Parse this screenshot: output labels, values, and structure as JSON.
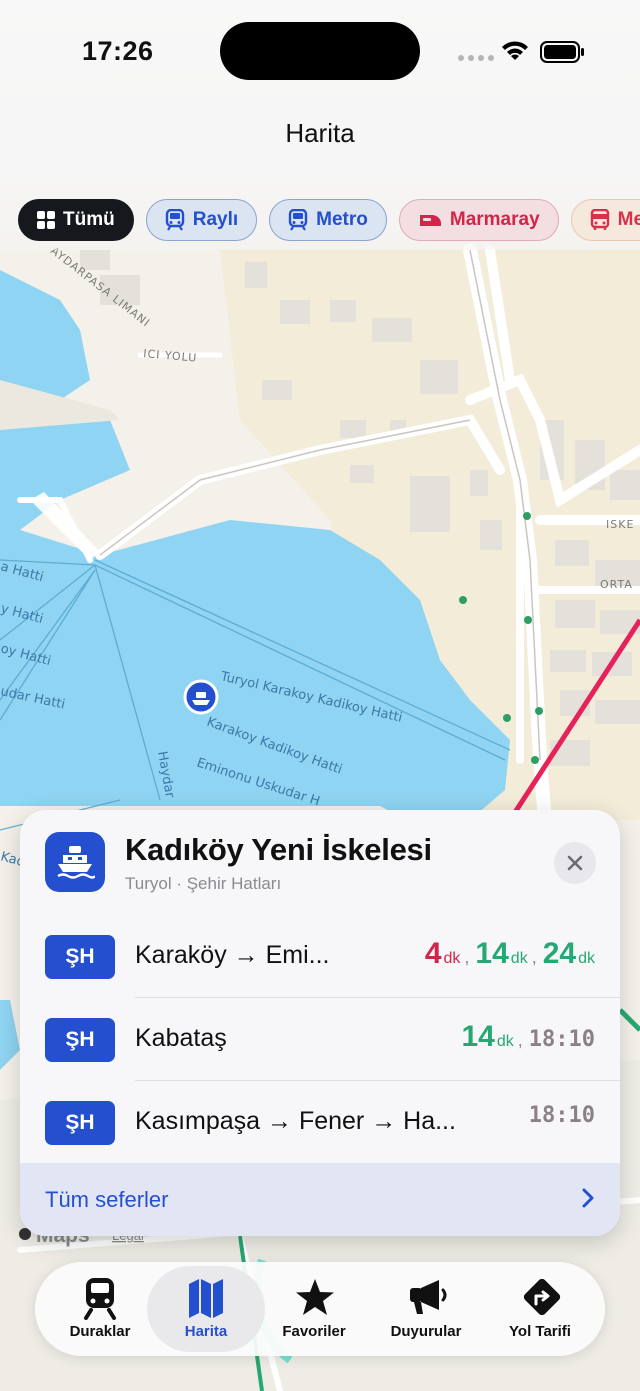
{
  "status_bar": {
    "time": "17:26"
  },
  "header": {
    "title": "Harita"
  },
  "filters": [
    {
      "label": "Tümü",
      "icon": "grid-icon",
      "selected": true
    },
    {
      "label": "Raylı",
      "icon": "tram-icon",
      "selected": false
    },
    {
      "label": "Metro",
      "icon": "metro-icon",
      "selected": false
    },
    {
      "label": "Marmaray",
      "icon": "train-icon",
      "selected": false
    },
    {
      "label": "Me",
      "icon": "bus-icon",
      "selected": false
    }
  ],
  "map": {
    "labels": {
      "port_road_1": "AYDARPASA LIMANI",
      "port_road_2": "ICI YOLU",
      "ferry_1": "Turyol Karakoy Kadikoy Hatti",
      "ferry_2": "Karakoy Kadikoy Hatti",
      "ferry_3": "Eminonu Uskudar H",
      "line_left_1": "a Hatti",
      "line_left_2": "y Hatti",
      "line_left_3": "oy Hatti",
      "line_left_4": "udar Hatti",
      "line_left_5": "Kad",
      "line_vertical": "Haydar",
      "street_1": "ISKE",
      "street_2": "ORTA",
      "maps_brand": "Maps",
      "legal": "Legal"
    }
  },
  "stop_card": {
    "name": "Kadıköy Yeni İskelesi",
    "subtitle": "Turyol · Şehir Hatları",
    "routes": [
      {
        "badge": "ŞH",
        "name": "Karaköy → Emi...",
        "times": [
          {
            "value": "4",
            "unit": "dk",
            "color": "#d32549"
          },
          {
            "value": "14",
            "unit": "dk",
            "color": "#27a872"
          },
          {
            "value": "24",
            "unit": "dk",
            "color": "#27a872"
          }
        ]
      },
      {
        "badge": "ŞH",
        "name": "Kabataş",
        "times": [
          {
            "value": "14",
            "unit": "dk",
            "color": "#27a872"
          }
        ],
        "scheduled": "18:10"
      },
      {
        "badge": "ŞH",
        "name": "Kasımpaşa → Fener → Ha...",
        "scheduled": "18:10"
      }
    ],
    "footer_label": "Tüm seferler"
  },
  "tab_bar": {
    "tabs": [
      {
        "label": "Duraklar",
        "icon": "tram-icon",
        "active": false
      },
      {
        "label": "Harita",
        "icon": "map-icon",
        "active": true
      },
      {
        "label": "Favoriler",
        "icon": "star-icon",
        "active": false
      },
      {
        "label": "Duyurular",
        "icon": "megaphone-icon",
        "active": false
      },
      {
        "label": "Yol Tarifi",
        "icon": "directions-icon",
        "active": false
      }
    ]
  },
  "colors": {
    "accent": "#2450d0",
    "due_soon": "#d32549",
    "on_time": "#27a872",
    "water": "#8fd4f2",
    "land": "#f4f1ea"
  }
}
